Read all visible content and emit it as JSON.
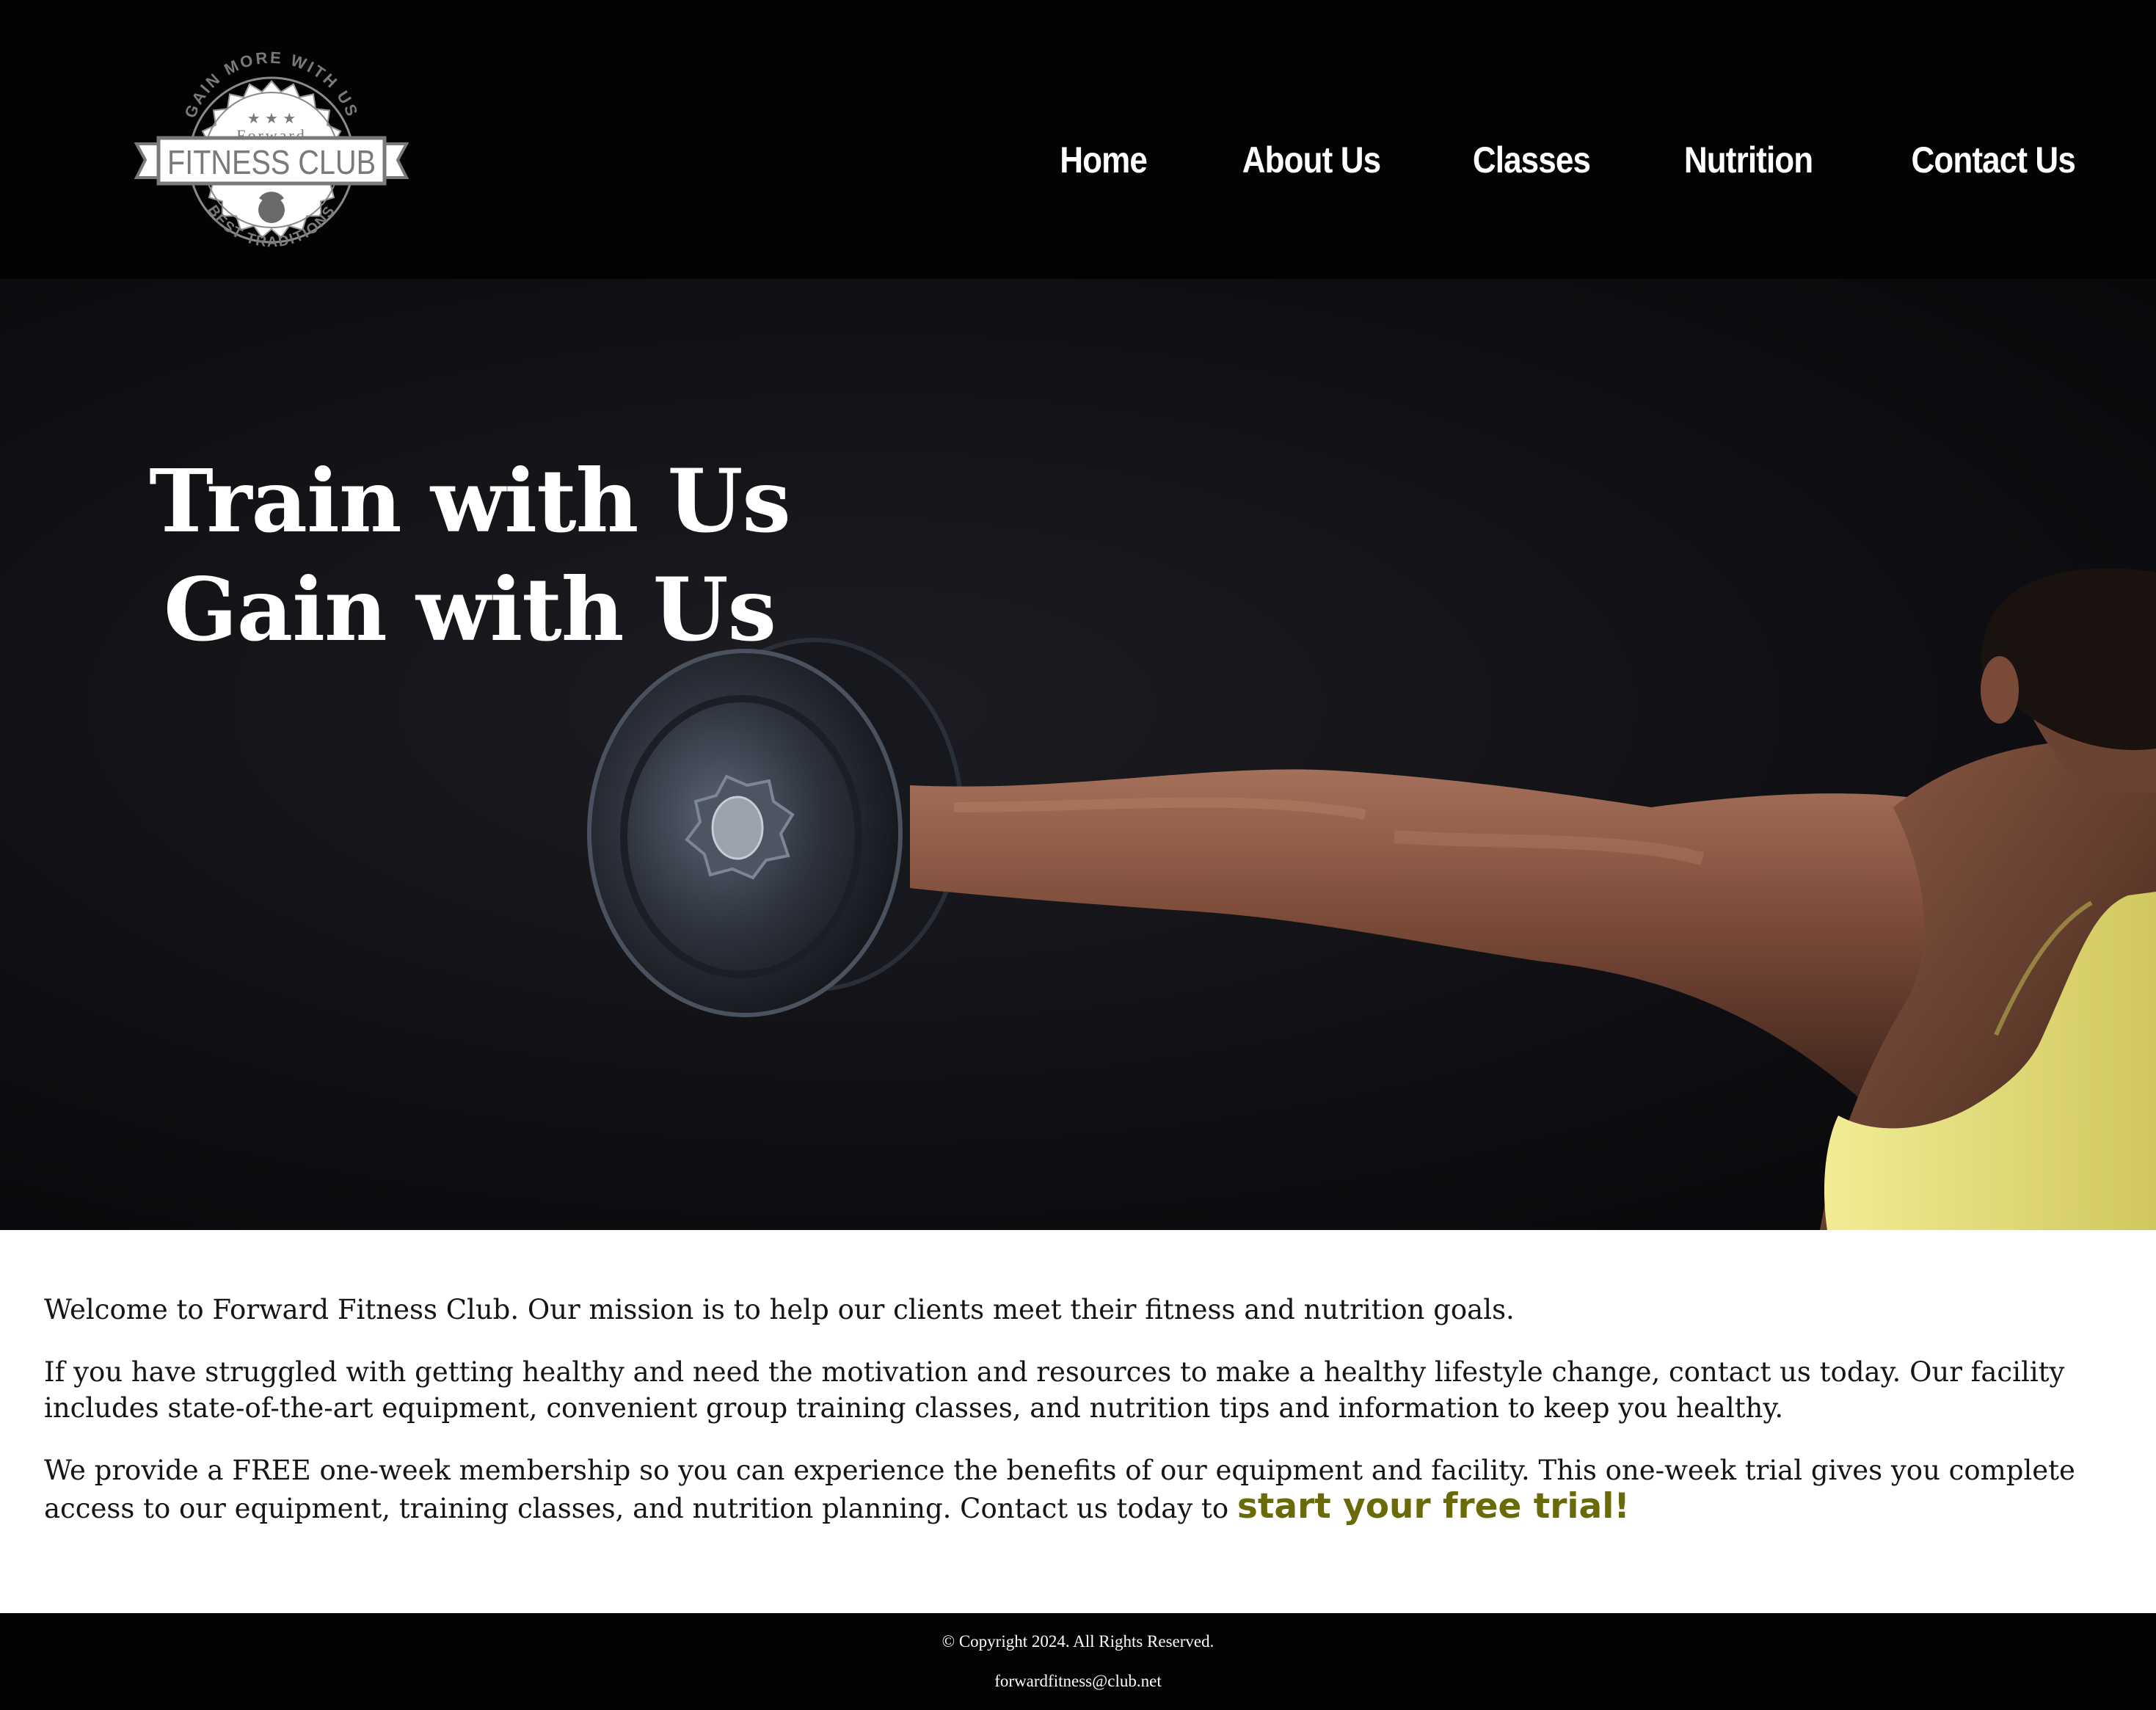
{
  "header": {
    "logo": {
      "arc_text": "GAIN MORE WITH US",
      "small_text": "Forward",
      "banner_text": "FITNESS CLUB",
      "bottom_text": "BEST TRADITIONS",
      "icon": "kettlebell-icon"
    },
    "nav": [
      "Home",
      "About Us",
      "Classes",
      "Nutrition",
      "Contact Us"
    ]
  },
  "hero": {
    "line1": "Train with Us",
    "line2": "Gain with Us"
  },
  "content": {
    "p1": "Welcome to Forward Fitness Club. Our mission is to help our clients meet their fitness and nutrition goals.",
    "p2": "If you have struggled with getting healthy and need the motivation and resources to make a healthy lifestyle change, contact us today. Our facility includes state-of-the-art equipment, convenient group training classes, and nutrition tips and information to keep you healthy.",
    "p3": "We provide a FREE one-week membership so you can experience the benefits of our equipment and facility. This one-week trial gives you complete access to our equipment, training classes, and nutrition planning. Contact us today to ",
    "cta": "start your free trial!"
  },
  "footer": {
    "copyright": "© Copyright 2024. All Rights Reserved.",
    "email": "forwardfitness@club.net"
  },
  "colors": {
    "header_bg": "#030303",
    "accent_link": "#6a6a08",
    "tank_top": "#e6df7a"
  }
}
